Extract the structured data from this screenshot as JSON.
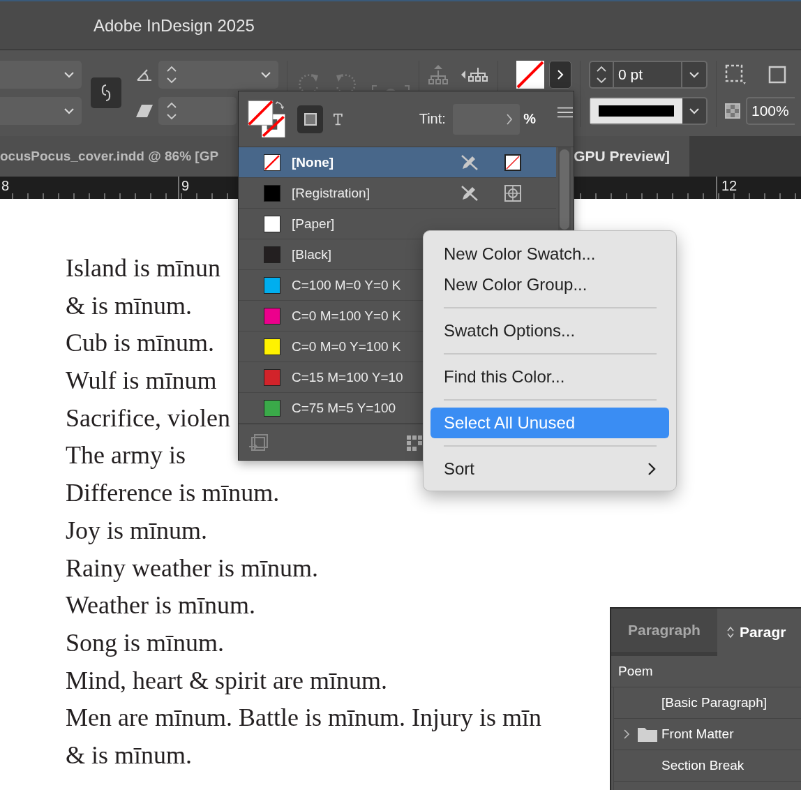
{
  "window": {
    "title": "Adobe InDesign 2025"
  },
  "control_bar": {
    "stroke_weight": "0 pt",
    "opacity": "100%"
  },
  "document_tab": {
    "text_left": "ocusPocus_cover.indd @ 86% [GP",
    "text_right": "GPU Preview]"
  },
  "ruler": {
    "labels": [
      "8",
      "9",
      "12"
    ]
  },
  "poem": {
    "stanzas": [
      [
        "Island is mīnun",
        "& is mīnum.",
        "Cub is mīnum.",
        "Wulf is mīnum",
        "Sacrifice, violen",
        "The army is",
        "Difference is mīnum.",
        "Joy is mīnum.",
        "Rainy weather is mīnum.",
        "Weather is mīnum.",
        "Song is mīnum.",
        "Mind, heart & spirit are mīnum.",
        "Men are mīnum. Battle is mīnum. Injury is mīn",
        "& is mīnum."
      ]
    ]
  },
  "swatches_panel": {
    "tint_label": "Tint:",
    "percent": "%",
    "swatches": [
      {
        "name": "[None]",
        "kind": "none",
        "locked": true,
        "selected": true
      },
      {
        "name": "[Registration]",
        "kind": "registration",
        "color": "#000000",
        "locked": true,
        "selected": false
      },
      {
        "name": "[Paper]",
        "kind": "process",
        "color": "#ffffff",
        "locked": false,
        "selected": false
      },
      {
        "name": "[Black]",
        "kind": "process",
        "color": "#231f20",
        "locked": false,
        "selected": false
      },
      {
        "name": "C=100 M=0 Y=0 K",
        "kind": "process",
        "color": "#00aeef",
        "locked": false,
        "selected": false
      },
      {
        "name": "C=0 M=100 Y=0 K",
        "kind": "process",
        "color": "#ec008c",
        "locked": false,
        "selected": false
      },
      {
        "name": "C=0 M=0 Y=100 K",
        "kind": "process",
        "color": "#fff200",
        "locked": false,
        "selected": false
      },
      {
        "name": "C=15 M=100 Y=10",
        "kind": "process",
        "color": "#d2232a",
        "locked": false,
        "selected": false
      },
      {
        "name": "C=75 M=5 Y=100",
        "kind": "process",
        "color": "#3aaa49",
        "locked": false,
        "selected": false
      }
    ]
  },
  "context_menu": {
    "items": [
      {
        "kind": "item",
        "label": "New Color Swatch...",
        "selected": false
      },
      {
        "kind": "item",
        "label": "New Color Group...",
        "selected": false
      },
      {
        "kind": "separator"
      },
      {
        "kind": "item",
        "label": "Swatch Options...",
        "selected": false
      },
      {
        "kind": "separator"
      },
      {
        "kind": "item",
        "label": "Find this Color...",
        "selected": false
      },
      {
        "kind": "separator"
      },
      {
        "kind": "item",
        "label": "Select All Unused",
        "selected": true
      },
      {
        "kind": "separator"
      },
      {
        "kind": "submenu",
        "label": "Sort",
        "selected": false
      }
    ]
  },
  "paragraph_styles_panel": {
    "tabs": [
      {
        "label": "Paragraph",
        "selected": false
      },
      {
        "label": "Paragr",
        "selected": true
      }
    ],
    "group": "Poem",
    "styles": [
      {
        "name": "[Basic Paragraph]",
        "kind": "style"
      },
      {
        "name": "Front Matter",
        "kind": "folder",
        "expanded": false
      },
      {
        "name": "Section Break",
        "kind": "style"
      }
    ]
  }
}
